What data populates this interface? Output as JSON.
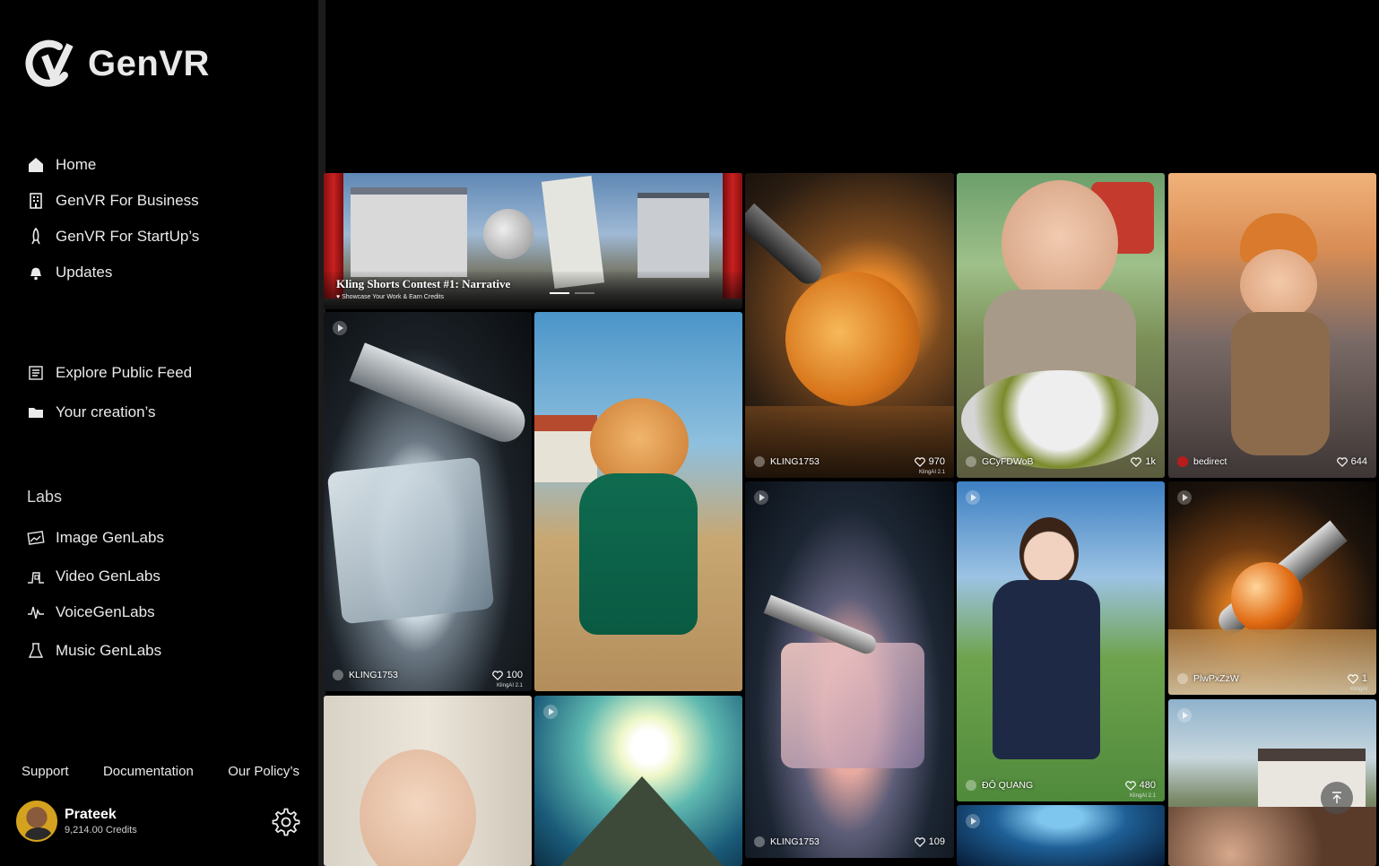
{
  "brand": {
    "name": "GenVR"
  },
  "nav": {
    "home": "Home",
    "business": "GenVR For Business",
    "startup": "GenVR For StartUp’s",
    "updates": "Updates",
    "explore": "Explore Public Feed",
    "creations": "Your creation’s"
  },
  "labs": {
    "title": "Labs",
    "image": "Image GenLabs",
    "video": "Video GenLabs",
    "voice": "VoiceGenLabs",
    "music": "Music GenLabs"
  },
  "footer": {
    "support": "Support",
    "docs": "Documentation",
    "policy": "Our Policy’s"
  },
  "user": {
    "name": "Prateek",
    "credits": "9,214.00 Credits"
  },
  "banner": {
    "title": "Kling Shorts Contest #1: Narrative",
    "subtitle": "Showcase Your Work & Earn Credits"
  },
  "feed": {
    "orange": {
      "user": "KLING1753",
      "likes": "970",
      "badge": "KlingAI 2.1"
    },
    "baby_eating": {
      "user": "GCyFDWoB",
      "likes": "1k"
    },
    "baby_orange_hat": {
      "user": "bedirect",
      "likes": "644"
    },
    "ice_knife": {
      "user": "KLING1753",
      "likes": "100",
      "badge": "KlingAI 2.1"
    },
    "woman_park": {
      "user": "ĐÔ QUANG",
      "likes": "480",
      "badge": "KlingAI 2.1"
    },
    "glass_ball": {
      "user": "PlwPxZzW",
      "likes": "1",
      "badge": "KlingAI"
    },
    "ice_glow": {
      "user": "KLING1753",
      "likes": "109"
    }
  }
}
